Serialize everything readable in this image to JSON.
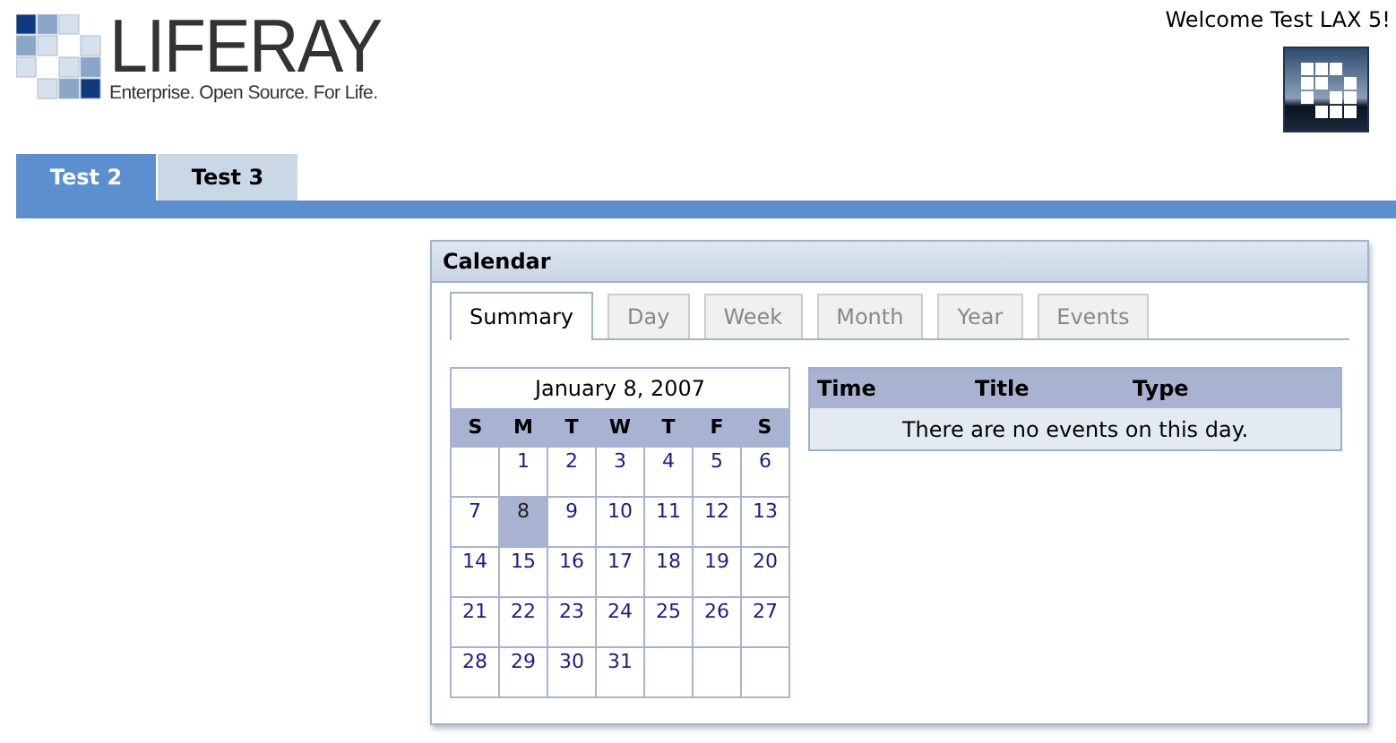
{
  "logo": {
    "name": "LIFERAY",
    "tagline": "Enterprise. Open Source. For Life."
  },
  "welcome": "Welcome Test LAX 5!",
  "page_tabs": [
    {
      "label": "Test 2",
      "selected": true
    },
    {
      "label": "Test 3",
      "selected": false
    }
  ],
  "portlet": {
    "title": "Calendar",
    "tabs": [
      {
        "label": "Summary",
        "selected": true
      },
      {
        "label": "Day",
        "selected": false
      },
      {
        "label": "Week",
        "selected": false
      },
      {
        "label": "Month",
        "selected": false
      },
      {
        "label": "Year",
        "selected": false
      },
      {
        "label": "Events",
        "selected": false
      }
    ],
    "mini_calendar": {
      "heading": "January 8, 2007",
      "weekdays": [
        "S",
        "M",
        "T",
        "W",
        "T",
        "F",
        "S"
      ],
      "weeks": [
        [
          {
            "kind": "blank"
          },
          {
            "kind": "day",
            "label": "1",
            "selected": false
          },
          {
            "kind": "day",
            "label": "2",
            "selected": false
          },
          {
            "kind": "day",
            "label": "3",
            "selected": false
          },
          {
            "kind": "day",
            "label": "4",
            "selected": false
          },
          {
            "kind": "day",
            "label": "5",
            "selected": false
          },
          {
            "kind": "day",
            "label": "6",
            "selected": false
          }
        ],
        [
          {
            "kind": "day",
            "label": "7",
            "selected": false
          },
          {
            "kind": "day",
            "label": "8",
            "selected": true
          },
          {
            "kind": "day",
            "label": "9",
            "selected": false
          },
          {
            "kind": "day",
            "label": "10",
            "selected": false
          },
          {
            "kind": "day",
            "label": "11",
            "selected": false
          },
          {
            "kind": "day",
            "label": "12",
            "selected": false
          },
          {
            "kind": "day",
            "label": "13",
            "selected": false
          }
        ],
        [
          {
            "kind": "day",
            "label": "14",
            "selected": false
          },
          {
            "kind": "day",
            "label": "15",
            "selected": false
          },
          {
            "kind": "day",
            "label": "16",
            "selected": false
          },
          {
            "kind": "day",
            "label": "17",
            "selected": false
          },
          {
            "kind": "day",
            "label": "18",
            "selected": false
          },
          {
            "kind": "day",
            "label": "19",
            "selected": false
          },
          {
            "kind": "day",
            "label": "20",
            "selected": false
          }
        ],
        [
          {
            "kind": "day",
            "label": "21",
            "selected": false
          },
          {
            "kind": "day",
            "label": "22",
            "selected": false
          },
          {
            "kind": "day",
            "label": "23",
            "selected": false
          },
          {
            "kind": "day",
            "label": "24",
            "selected": false
          },
          {
            "kind": "day",
            "label": "25",
            "selected": false
          },
          {
            "kind": "day",
            "label": "26",
            "selected": false
          },
          {
            "kind": "day",
            "label": "27",
            "selected": false
          }
        ],
        [
          {
            "kind": "day",
            "label": "28",
            "selected": false
          },
          {
            "kind": "day",
            "label": "29",
            "selected": false
          },
          {
            "kind": "day",
            "label": "30",
            "selected": false
          },
          {
            "kind": "day",
            "label": "31",
            "selected": false
          },
          {
            "kind": "blank"
          },
          {
            "kind": "blank"
          },
          {
            "kind": "blank"
          }
        ]
      ]
    },
    "events_table": {
      "columns": [
        "Time",
        "Title",
        "Type"
      ],
      "empty_message": "There are no events on this day."
    }
  }
}
